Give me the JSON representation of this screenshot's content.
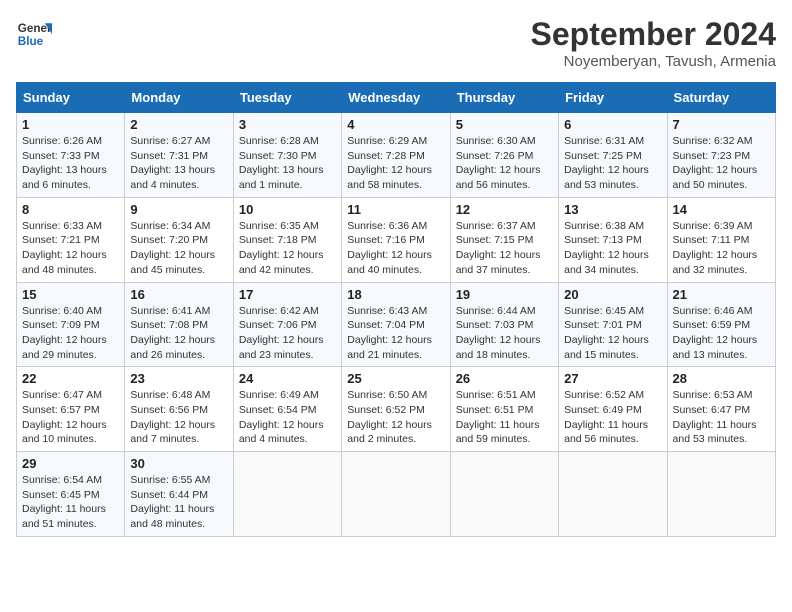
{
  "header": {
    "logo_line1": "General",
    "logo_line2": "Blue",
    "title": "September 2024",
    "subtitle": "Noyemberyan, Tavush, Armenia"
  },
  "days_of_week": [
    "Sunday",
    "Monday",
    "Tuesday",
    "Wednesday",
    "Thursday",
    "Friday",
    "Saturday"
  ],
  "weeks": [
    [
      {
        "day": "1",
        "info": "Sunrise: 6:26 AM\nSunset: 7:33 PM\nDaylight: 13 hours and 6 minutes."
      },
      {
        "day": "2",
        "info": "Sunrise: 6:27 AM\nSunset: 7:31 PM\nDaylight: 13 hours and 4 minutes."
      },
      {
        "day": "3",
        "info": "Sunrise: 6:28 AM\nSunset: 7:30 PM\nDaylight: 13 hours and 1 minute."
      },
      {
        "day": "4",
        "info": "Sunrise: 6:29 AM\nSunset: 7:28 PM\nDaylight: 12 hours and 58 minutes."
      },
      {
        "day": "5",
        "info": "Sunrise: 6:30 AM\nSunset: 7:26 PM\nDaylight: 12 hours and 56 minutes."
      },
      {
        "day": "6",
        "info": "Sunrise: 6:31 AM\nSunset: 7:25 PM\nDaylight: 12 hours and 53 minutes."
      },
      {
        "day": "7",
        "info": "Sunrise: 6:32 AM\nSunset: 7:23 PM\nDaylight: 12 hours and 50 minutes."
      }
    ],
    [
      {
        "day": "8",
        "info": "Sunrise: 6:33 AM\nSunset: 7:21 PM\nDaylight: 12 hours and 48 minutes."
      },
      {
        "day": "9",
        "info": "Sunrise: 6:34 AM\nSunset: 7:20 PM\nDaylight: 12 hours and 45 minutes."
      },
      {
        "day": "10",
        "info": "Sunrise: 6:35 AM\nSunset: 7:18 PM\nDaylight: 12 hours and 42 minutes."
      },
      {
        "day": "11",
        "info": "Sunrise: 6:36 AM\nSunset: 7:16 PM\nDaylight: 12 hours and 40 minutes."
      },
      {
        "day": "12",
        "info": "Sunrise: 6:37 AM\nSunset: 7:15 PM\nDaylight: 12 hours and 37 minutes."
      },
      {
        "day": "13",
        "info": "Sunrise: 6:38 AM\nSunset: 7:13 PM\nDaylight: 12 hours and 34 minutes."
      },
      {
        "day": "14",
        "info": "Sunrise: 6:39 AM\nSunset: 7:11 PM\nDaylight: 12 hours and 32 minutes."
      }
    ],
    [
      {
        "day": "15",
        "info": "Sunrise: 6:40 AM\nSunset: 7:09 PM\nDaylight: 12 hours and 29 minutes."
      },
      {
        "day": "16",
        "info": "Sunrise: 6:41 AM\nSunset: 7:08 PM\nDaylight: 12 hours and 26 minutes."
      },
      {
        "day": "17",
        "info": "Sunrise: 6:42 AM\nSunset: 7:06 PM\nDaylight: 12 hours and 23 minutes."
      },
      {
        "day": "18",
        "info": "Sunrise: 6:43 AM\nSunset: 7:04 PM\nDaylight: 12 hours and 21 minutes."
      },
      {
        "day": "19",
        "info": "Sunrise: 6:44 AM\nSunset: 7:03 PM\nDaylight: 12 hours and 18 minutes."
      },
      {
        "day": "20",
        "info": "Sunrise: 6:45 AM\nSunset: 7:01 PM\nDaylight: 12 hours and 15 minutes."
      },
      {
        "day": "21",
        "info": "Sunrise: 6:46 AM\nSunset: 6:59 PM\nDaylight: 12 hours and 13 minutes."
      }
    ],
    [
      {
        "day": "22",
        "info": "Sunrise: 6:47 AM\nSunset: 6:57 PM\nDaylight: 12 hours and 10 minutes."
      },
      {
        "day": "23",
        "info": "Sunrise: 6:48 AM\nSunset: 6:56 PM\nDaylight: 12 hours and 7 minutes."
      },
      {
        "day": "24",
        "info": "Sunrise: 6:49 AM\nSunset: 6:54 PM\nDaylight: 12 hours and 4 minutes."
      },
      {
        "day": "25",
        "info": "Sunrise: 6:50 AM\nSunset: 6:52 PM\nDaylight: 12 hours and 2 minutes."
      },
      {
        "day": "26",
        "info": "Sunrise: 6:51 AM\nSunset: 6:51 PM\nDaylight: 11 hours and 59 minutes."
      },
      {
        "day": "27",
        "info": "Sunrise: 6:52 AM\nSunset: 6:49 PM\nDaylight: 11 hours and 56 minutes."
      },
      {
        "day": "28",
        "info": "Sunrise: 6:53 AM\nSunset: 6:47 PM\nDaylight: 11 hours and 53 minutes."
      }
    ],
    [
      {
        "day": "29",
        "info": "Sunrise: 6:54 AM\nSunset: 6:45 PM\nDaylight: 11 hours and 51 minutes."
      },
      {
        "day": "30",
        "info": "Sunrise: 6:55 AM\nSunset: 6:44 PM\nDaylight: 11 hours and 48 minutes."
      },
      {
        "day": "",
        "info": ""
      },
      {
        "day": "",
        "info": ""
      },
      {
        "day": "",
        "info": ""
      },
      {
        "day": "",
        "info": ""
      },
      {
        "day": "",
        "info": ""
      }
    ]
  ]
}
